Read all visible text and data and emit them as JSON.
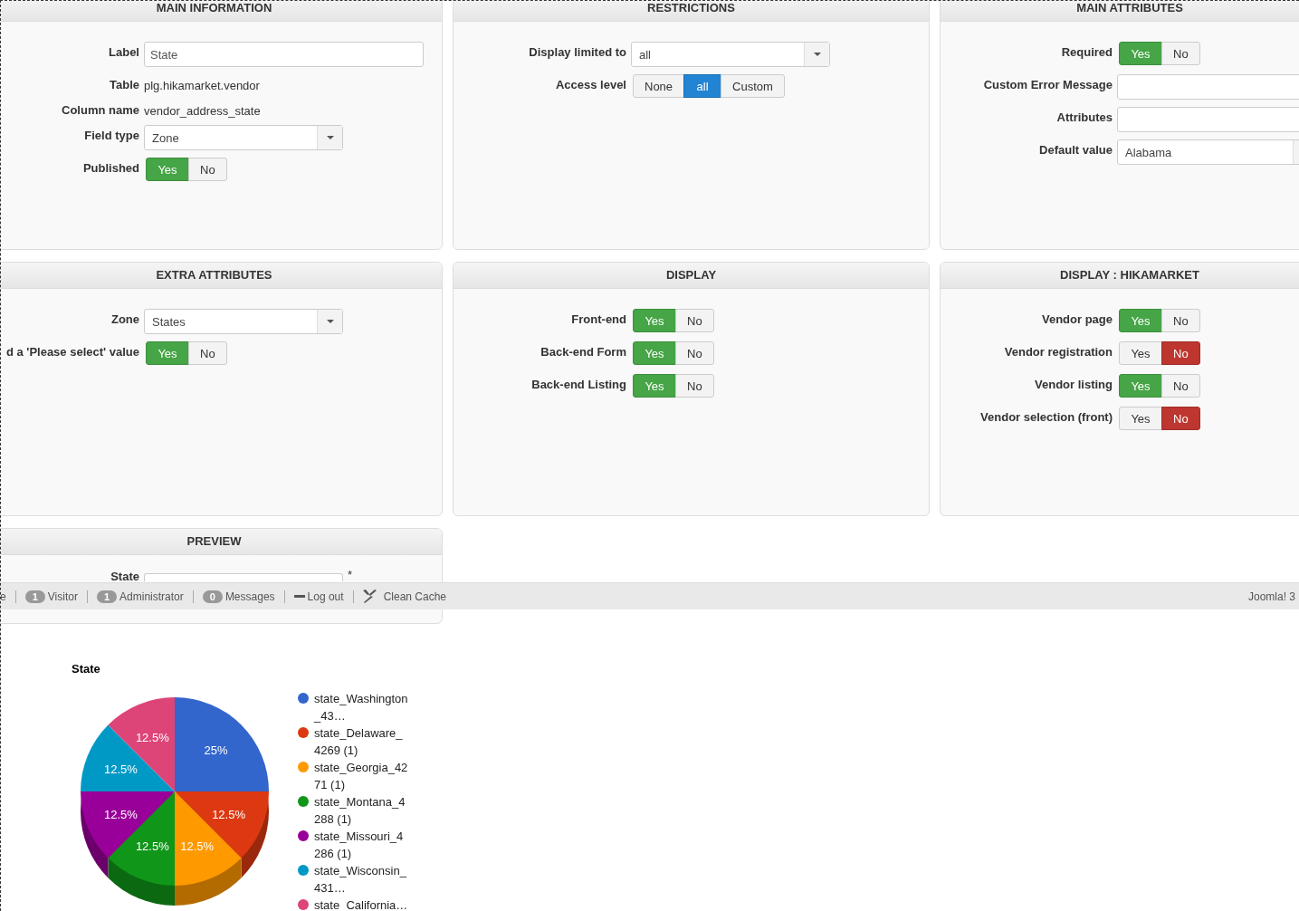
{
  "panels": [
    {
      "title": "MAIN INFORMATION",
      "rows": [
        {
          "kind": "input",
          "label": "Label",
          "value": "State"
        },
        {
          "kind": "text",
          "label": "Table",
          "value": "plg.hikamarket.vendor"
        },
        {
          "kind": "text",
          "label": "Column name",
          "value": "vendor_address_state"
        },
        {
          "kind": "select",
          "label": "Field type",
          "value": "Zone"
        },
        {
          "kind": "toggle",
          "label": "Published",
          "options": [
            {
              "label": "Yes",
              "selected": true
            },
            {
              "label": "No",
              "selected": false
            }
          ]
        }
      ]
    },
    {
      "title": "RESTRICTIONS",
      "rows": [
        {
          "kind": "select",
          "label": "Display limited to",
          "value": "all"
        },
        {
          "kind": "segmented",
          "label": "Access level",
          "options": [
            {
              "label": "None",
              "selected": false
            },
            {
              "label": "all",
              "selected": true
            },
            {
              "label": "Custom",
              "selected": false
            }
          ]
        }
      ]
    },
    {
      "title": "MAIN ATTRIBUTES",
      "rows": [
        {
          "kind": "toggle",
          "label": "Required",
          "options": [
            {
              "label": "Yes",
              "selected": true
            },
            {
              "label": "No",
              "selected": false
            }
          ]
        },
        {
          "kind": "input",
          "label": "Custom Error Message"
        },
        {
          "kind": "input",
          "label": "Attributes"
        },
        {
          "kind": "select",
          "label": "Default value",
          "value": "Alabama"
        }
      ]
    },
    {
      "title": "EXTRA ATTRIBUTES",
      "rows": [
        {
          "kind": "select",
          "label": "Zone",
          "value": "States"
        },
        {
          "kind": "toggle",
          "label": "d a 'Please select' value",
          "options": [
            {
              "label": "Yes",
              "selected": true
            },
            {
              "label": "No",
              "selected": false
            }
          ]
        }
      ]
    },
    {
      "title": "DISPLAY",
      "rows": [
        {
          "kind": "toggle",
          "label": "Front-end",
          "options": [
            {
              "label": "Yes",
              "selected": true
            },
            {
              "label": "No",
              "selected": false
            }
          ]
        },
        {
          "kind": "toggle",
          "label": "Back-end Form",
          "options": [
            {
              "label": "Yes",
              "selected": true
            },
            {
              "label": "No",
              "selected": false
            }
          ]
        },
        {
          "kind": "toggle",
          "label": "Back-end Listing",
          "options": [
            {
              "label": "Yes",
              "selected": true
            },
            {
              "label": "No",
              "selected": false
            }
          ]
        }
      ]
    },
    {
      "title": "DISPLAY : HIKAMARKET",
      "rows": [
        {
          "kind": "toggle",
          "label": "Vendor page",
          "options": [
            {
              "label": "Yes",
              "selected": true
            },
            {
              "label": "No",
              "selected": false
            }
          ]
        },
        {
          "kind": "toggle",
          "label": "Vendor registration",
          "options": [
            {
              "label": "Yes",
              "selected": false
            },
            {
              "label": "No",
              "selected": true
            }
          ]
        },
        {
          "kind": "toggle",
          "label": "Vendor listing",
          "options": [
            {
              "label": "Yes",
              "selected": true
            },
            {
              "label": "No",
              "selected": false
            }
          ]
        },
        {
          "kind": "toggle",
          "label": "Vendor selection (front)",
          "options": [
            {
              "label": "Yes",
              "selected": false
            },
            {
              "label": "No",
              "selected": true
            }
          ]
        }
      ]
    }
  ],
  "preview": {
    "title": "PREVIEW",
    "field_label": "State",
    "required_mark": "*"
  },
  "status_bar": {
    "items": [
      {
        "kind": "text",
        "label": "e"
      },
      {
        "kind": "count",
        "count": "1",
        "label": "Visitor"
      },
      {
        "kind": "count",
        "count": "1",
        "label": "Administrator"
      },
      {
        "kind": "count",
        "count": "0",
        "label": "Messages"
      },
      {
        "kind": "logout",
        "label": "Log out"
      },
      {
        "kind": "cache",
        "label": "Clean Cache"
      }
    ],
    "version": "Joomla! 3"
  },
  "chart": {
    "chart_data": {
      "type": "pie",
      "title": "State",
      "categories": [
        "state_Washington_43…",
        "state_Delaware_4269 (1)",
        "state_Georgia_4271 (1)",
        "state_Montana_4288 (1)",
        "state_Missouri_4286 (1)",
        "state_Wisconsin_431…",
        "state_California…"
      ],
      "values": [
        25,
        12.5,
        12.5,
        12.5,
        12.5,
        12.5,
        12.5
      ],
      "colors": [
        "#3366cc",
        "#dc3912",
        "#ff9900",
        "#109618",
        "#990099",
        "#0099c6",
        "#dd4477"
      ],
      "value_labels": [
        "25%",
        "12.5%",
        "12.5%",
        "12.5%",
        "12.5%",
        "12.5%",
        "12.5%"
      ],
      "legend": "right"
    }
  }
}
